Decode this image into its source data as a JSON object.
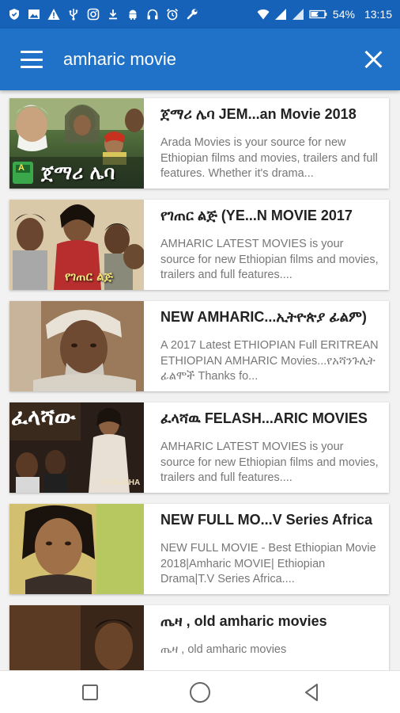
{
  "status_bar": {
    "battery": "54%",
    "time": "13:15",
    "icons": [
      "shield-icon",
      "image-icon",
      "warning-icon",
      "usb-icon",
      "instagram-icon",
      "download-icon",
      "android-icon",
      "headphones-icon",
      "alarm-icon",
      "wrench-icon",
      "wifi-icon",
      "signal-icon",
      "battery-icon"
    ]
  },
  "app_bar": {
    "search_query": "amharic movie",
    "icons": [
      "menu-icon",
      "close-icon"
    ]
  },
  "results": [
    {
      "title": "ጀማሪ ሌባ JEM...an Movie 2018",
      "description": "Arada Movies is your source for new Ethiopian films and movies, trailers and full features. Whether it's drama...",
      "thumbnail_caption": "ጀማሪ ሌባ",
      "thumbnail_badge": "A"
    },
    {
      "title": "የገጠር ልጅ (YE...N MOVIE 2017",
      "description": "AMHARIC LATEST MOVIES is your source for new Ethiopian films and movies, trailers and full features....",
      "thumbnail_caption": "የገጠር ልጅ"
    },
    {
      "title": "NEW AMHARIC...ኢትዮጵያ ፊልም)",
      "description": "A 2017 Latest ETHIOPIAN Full ERITREAN ETHIOPIAN AMHARIC Movies...የአሻንጉሊት ፊልሞች Thanks fo..."
    },
    {
      "title": "ፈላሻዉ FELASH...ARIC MOVIES",
      "description": "AMHARIC LATEST MOVIES is your source for new Ethiopian films and movies, trailers and full features....",
      "thumbnail_caption": "ፈላሻው",
      "thumbnail_subcaption": "FELASHA"
    },
    {
      "title": "NEW FULL MO...V Series Africa",
      "description": "NEW FULL MOVIE - Best Ethiopian Movie 2018|Amharic MOVIE| Ethiopian Drama|T.V Series Africa...."
    },
    {
      "title": "ጤዛ , old amharic movies",
      "description": "ጤዛ , old amharic movies"
    }
  ],
  "nav_bar": {
    "icons": [
      "recent-apps-icon",
      "home-icon",
      "back-icon"
    ]
  },
  "colors": {
    "status_bar": "#1662b8",
    "app_bar": "#1f72c8",
    "background": "#f2f2f2",
    "title_text": "#222222",
    "description_text": "#777777"
  }
}
